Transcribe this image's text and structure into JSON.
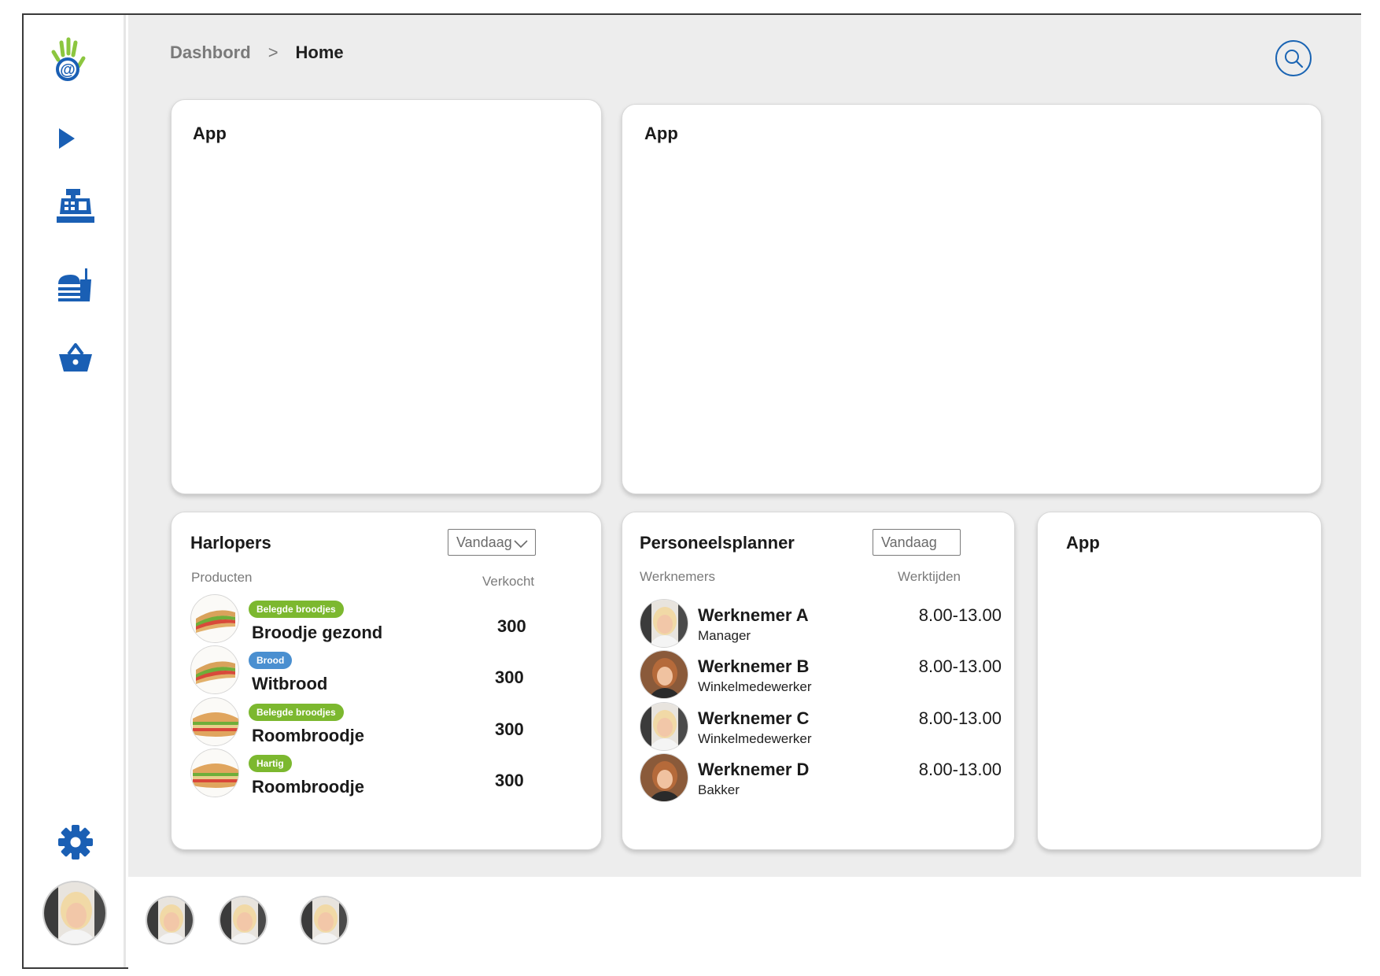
{
  "breadcrumb": {
    "parent": "Dashbord",
    "separator": ">",
    "current": "Home"
  },
  "sidebar": {
    "icons": [
      "logo-hand-icon",
      "play-icon",
      "cash-register-icon",
      "food-icon",
      "basket-icon",
      "gear-icon"
    ],
    "accent": "#1a5fb4"
  },
  "cards": {
    "app1_title": "App",
    "app2_title": "App",
    "app3_title": "App"
  },
  "harlopers": {
    "title": "Harlopers",
    "dropdown": "Vandaag",
    "col_products": "Producten",
    "col_sold": "Verkocht",
    "items": [
      {
        "badge": "Belegde broodjes",
        "badge_color": "#7cb82f",
        "name": "Broodje gezond",
        "sold": "300"
      },
      {
        "badge": "Brood",
        "badge_color": "#4a8fd0",
        "name": "Witbrood",
        "sold": "300"
      },
      {
        "badge": "Belegde broodjes",
        "badge_color": "#7cb82f",
        "name": "Roombroodje",
        "sold": "300"
      },
      {
        "badge": "Hartig",
        "badge_color": "#7cb82f",
        "name": "Roombroodje",
        "sold": "300"
      }
    ]
  },
  "planner": {
    "title": "Personeelsplanner",
    "dropdown": "Vandaag",
    "col_employees": "Werknemers",
    "col_hours": "Werktijden",
    "items": [
      {
        "name": "Werknemer A",
        "role": "Manager",
        "hours": "8.00-13.00"
      },
      {
        "name": "Werknemer B",
        "role": "Winkelmedewerker",
        "hours": "8.00-13.00"
      },
      {
        "name": "Werknemer C",
        "role": "Winkelmedewerker",
        "hours": "8.00-13.00"
      },
      {
        "name": "Werknemer D",
        "role": "Bakker",
        "hours": "8.00-13.00"
      }
    ]
  }
}
